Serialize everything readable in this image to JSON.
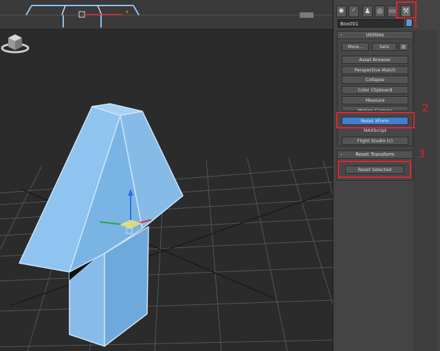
{
  "object_name": "Box001",
  "tabs": [
    {
      "icon": "sun-icon",
      "glyph": "✺"
    },
    {
      "icon": "curve-icon",
      "glyph": "◜"
    },
    {
      "icon": "hierarchy-icon",
      "glyph": "♟"
    },
    {
      "icon": "motion-icon",
      "glyph": "◎"
    },
    {
      "icon": "display-icon",
      "glyph": "▭"
    },
    {
      "icon": "hammer-icon",
      "glyph": "⚒"
    }
  ],
  "utilities": {
    "title": "Utilities",
    "more_label": "More...",
    "sets_label": "Sets",
    "items": [
      "Asset Browser",
      "Perspective Match",
      "Collapse",
      "Color Clipboard",
      "Measure",
      "Motion Capture",
      "Reset XForm",
      "MAXScript",
      "Flight Studio (c)"
    ],
    "selected": "Reset XForm"
  },
  "reset_transform": {
    "title": "Reset Transform",
    "button_label": "Reset Selected"
  },
  "annotations": [
    "1",
    "2",
    "3"
  ],
  "viewport": {
    "axis_label": "x"
  },
  "colors": {
    "accent": "#3f7fcf",
    "annotation": "#e2242f",
    "object": "#8fc3f0"
  }
}
